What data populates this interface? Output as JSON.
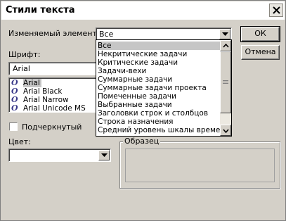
{
  "window": {
    "title": "Стили текста"
  },
  "element": {
    "label": "Изменяемый элемент:",
    "value": "Все",
    "options": [
      "Все",
      "Некритические задачи",
      "Критические задачи",
      "Задачи-вехи",
      "Суммарные задачи",
      "Суммарные задачи проекта",
      "Помеченные задачи",
      "Выбранные задачи",
      "Заголовки строк и столбцов",
      "Строка назначения",
      "Средний уровень шкалы времени"
    ]
  },
  "font": {
    "label": "Шрифт:",
    "value": "Arial",
    "items": [
      "Arial",
      "Arial Black",
      "Arial Narrow",
      "Arial Unicode MS"
    ]
  },
  "underline": {
    "label": "Подчеркнутый",
    "checked": false
  },
  "color": {
    "label": "Цвет:",
    "value": ""
  },
  "sample": {
    "label": "Образец"
  },
  "buttons": {
    "ok": "ОК",
    "cancel": "Отмена"
  },
  "icons": {
    "close": "close-icon",
    "dropdown": "chevron-down-icon",
    "scroll_up": "scroll-up-icon",
    "scroll_down": "scroll-down-icon",
    "font_type": "opentype-font-icon"
  }
}
